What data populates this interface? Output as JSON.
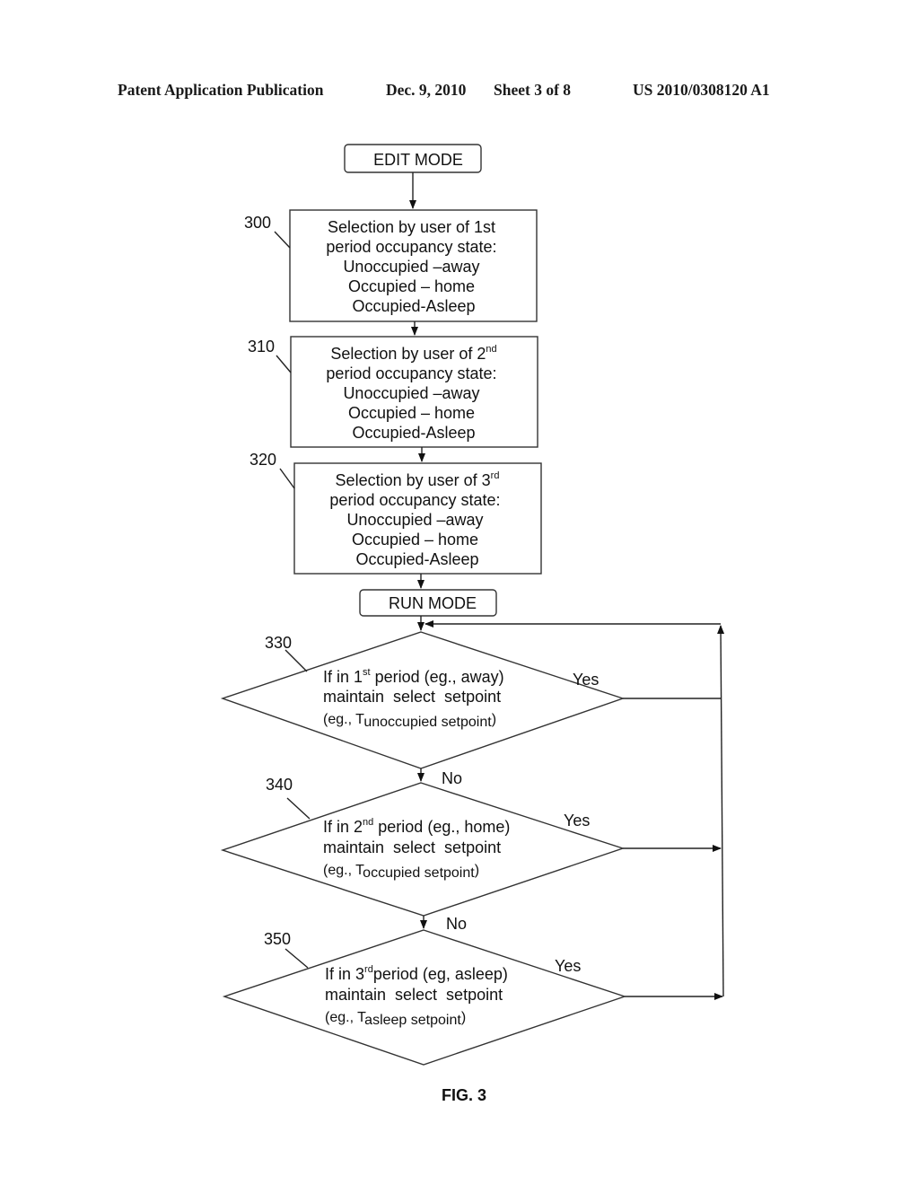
{
  "header": {
    "left": "Patent Application Publication",
    "date": "Dec. 9, 2010",
    "sheet": "Sheet 3 of 8",
    "number": "US 2010/0308120 A1"
  },
  "flowchart": {
    "start": "EDIT MODE",
    "run": "RUN MODE",
    "selection_boxes": [
      {
        "ref": "300",
        "line1_pre": "Selection by user of 1st",
        "line1_sup": "",
        "line2": "period occupancy state:",
        "line3": "Unoccupied –away",
        "line4": "Occupied – home",
        "line5": "Occupied-Asleep"
      },
      {
        "ref": "310",
        "line1_pre": "Selection by user of 2",
        "line1_sup": "nd",
        "line2": "period occupancy state:",
        "line3": "Unoccupied –away",
        "line4": "Occupied – home",
        "line5": "Occupied-Asleep"
      },
      {
        "ref": "320",
        "line1_pre": "Selection by user of 3",
        "line1_sup": "rd",
        "line2": "period occupancy state:",
        "line3": "Unoccupied –away",
        "line4": "Occupied – home",
        "line5": "Occupied-Asleep"
      }
    ],
    "decisions": [
      {
        "ref": "330",
        "l1_pre": "If in 1",
        "l1_sup": "st",
        "l1_post": " period (eg., away)",
        "l2": "maintain  select  setpoint",
        "l3_pre": "(eg., T",
        "l3_sub": "unoccupied setpoint",
        "l3_post": ")",
        "yes": "Yes",
        "no": "No"
      },
      {
        "ref": "340",
        "l1_pre": "If in 2",
        "l1_sup": "nd",
        "l1_post": " period (eg., home)",
        "l2": "maintain  select  setpoint",
        "l3_pre": "(eg., T",
        "l3_sub": "occupied setpoint",
        "l3_post": ")",
        "yes": "Yes",
        "no": "No"
      },
      {
        "ref": "350",
        "l1_pre": "If in 3",
        "l1_sup": "rd",
        "l1_post": "period (eg, asleep)",
        "l2": "maintain  select  setpoint",
        "l3_pre": "(eg., T",
        "l3_sub": "asleep setpoint",
        "l3_post": ")",
        "yes": "Yes"
      }
    ],
    "figure_label": "FIG. 3"
  }
}
